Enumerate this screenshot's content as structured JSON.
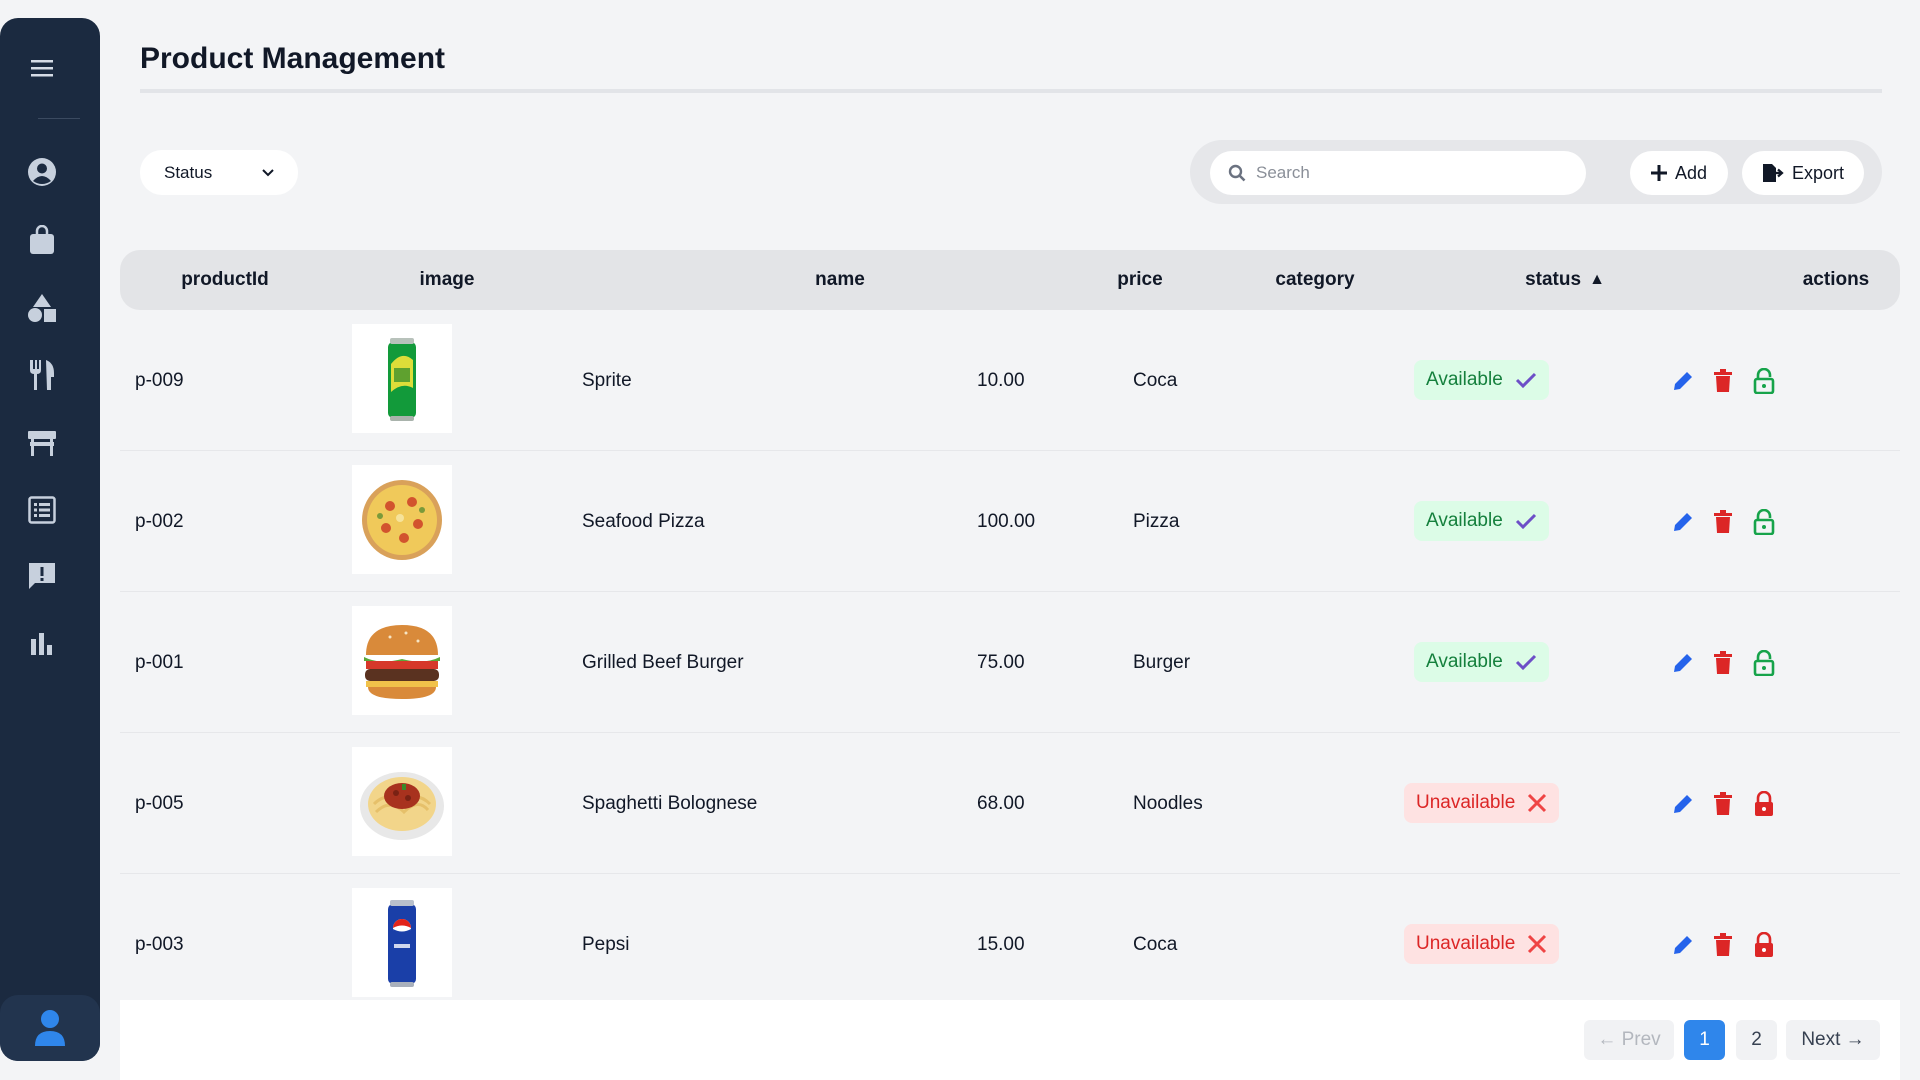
{
  "page": {
    "title": "Product Management"
  },
  "sidebar": {
    "items": [
      {
        "icon": "menu-icon"
      },
      {
        "icon": "user-circle-icon"
      },
      {
        "icon": "shopping-bag-icon"
      },
      {
        "icon": "shapes-icon"
      },
      {
        "icon": "utensils-icon"
      },
      {
        "icon": "table-icon"
      },
      {
        "icon": "list-icon"
      },
      {
        "icon": "feedback-icon"
      },
      {
        "icon": "chart-icon"
      }
    ],
    "user_icon": "user-icon"
  },
  "filters": {
    "status_label": "Status"
  },
  "toolbar": {
    "search_placeholder": "Search",
    "add_label": "Add",
    "export_label": "Export"
  },
  "table": {
    "columns": {
      "productId": "productId",
      "image": "image",
      "name": "name",
      "price": "price",
      "category": "category",
      "status": "status",
      "actions": "actions"
    },
    "sort_indicator": "▲",
    "rows": [
      {
        "productId": "p-009",
        "image": "sprite-can",
        "name": "Sprite",
        "price": "10.00",
        "category": "Coca",
        "status": "Available",
        "locked": false
      },
      {
        "productId": "p-002",
        "image": "seafood-pizza",
        "name": "Seafood Pizza",
        "price": "100.00",
        "category": "Pizza",
        "status": "Available",
        "locked": false
      },
      {
        "productId": "p-001",
        "image": "beef-burger",
        "name": "Grilled Beef Burger",
        "price": "75.00",
        "category": "Burger",
        "status": "Available",
        "locked": false
      },
      {
        "productId": "p-005",
        "image": "spaghetti-plate",
        "name": "Spaghetti Bolognese",
        "price": "68.00",
        "category": "Noodles",
        "status": "Unavailable",
        "locked": true
      },
      {
        "productId": "p-003",
        "image": "pepsi-can",
        "name": "Pepsi",
        "price": "15.00",
        "category": "Coca",
        "status": "Unavailable",
        "locked": true
      }
    ]
  },
  "pagination": {
    "prev_label": "← Prev",
    "pages": [
      "1",
      "2"
    ],
    "current": "1",
    "next_label": "Next →"
  },
  "colors": {
    "sidebar": "#1b2a40",
    "accent": "#2f86eb",
    "available": "#15803d",
    "unavailable": "#dc2626",
    "edit": "#2563eb",
    "delete": "#dc2626",
    "unlock": "#16a34a",
    "lock": "#dc2626"
  }
}
